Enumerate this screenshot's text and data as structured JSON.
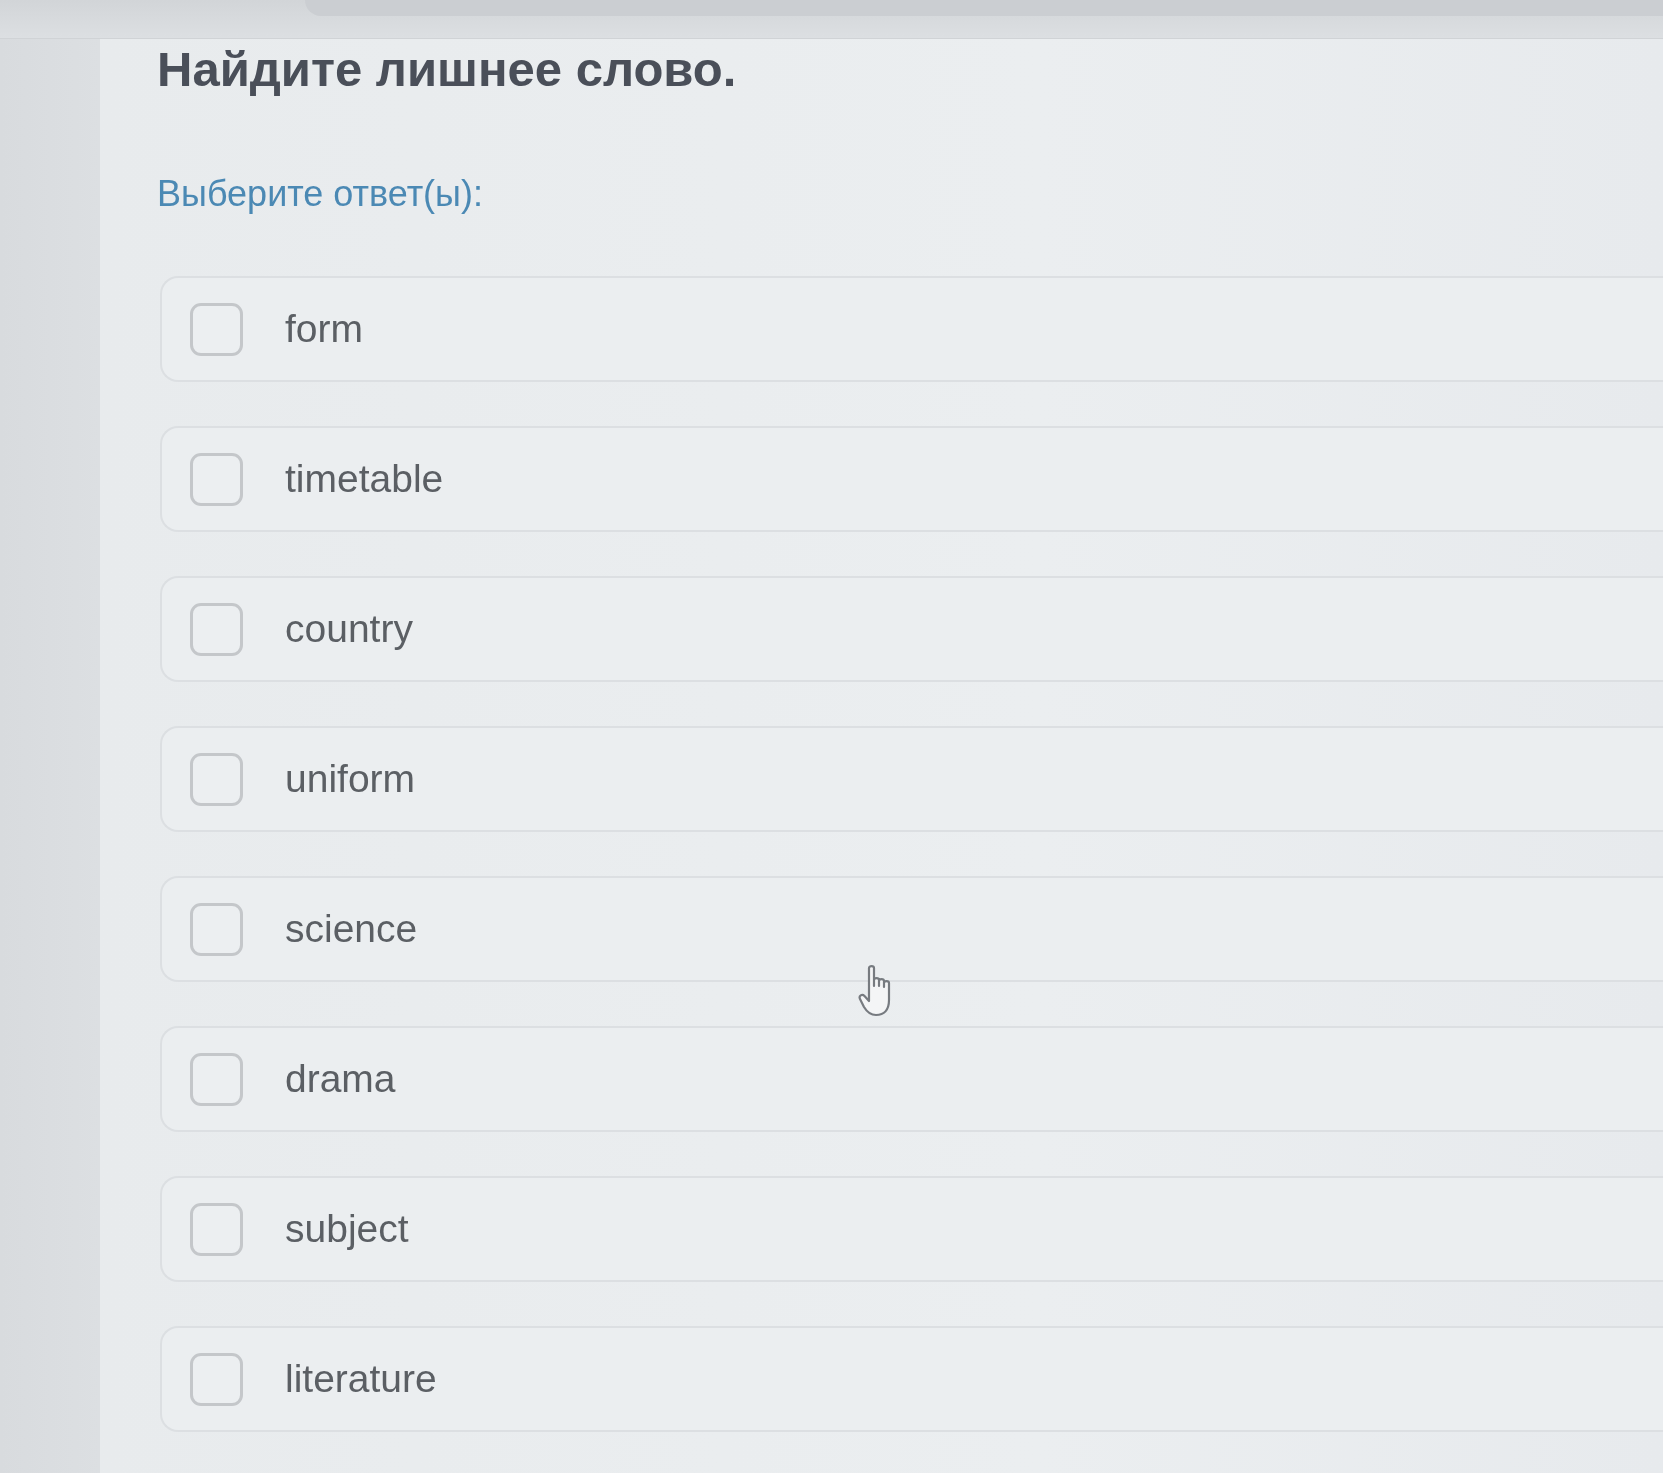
{
  "question": {
    "title": "Найдите лишнее слово.",
    "prompt": "Выберите ответ(ы):"
  },
  "options": [
    {
      "label": "form",
      "checked": false
    },
    {
      "label": "timetable",
      "checked": false
    },
    {
      "label": "country",
      "checked": false
    },
    {
      "label": "uniform",
      "checked": false
    },
    {
      "label": "science",
      "checked": false
    },
    {
      "label": "drama",
      "checked": false
    },
    {
      "label": "subject",
      "checked": false
    },
    {
      "label": "literature",
      "checked": false
    }
  ]
}
